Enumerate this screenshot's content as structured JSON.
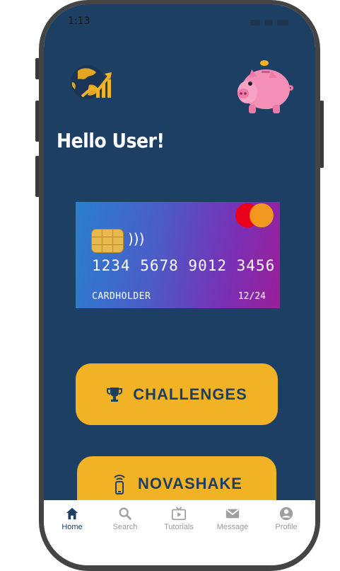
{
  "status_bar": {
    "time": "1:13"
  },
  "header": {
    "greeting": "Hello User!",
    "globe_icon": "globe-growth-chart-icon",
    "piggy_icon": "piggy-bank-icon"
  },
  "card": {
    "number": "1234 5678 9012 3456",
    "holder": "CARDHOLDER",
    "expiry": "12/24",
    "brand": "mastercard",
    "gradient": [
      "#2a7fd0",
      "#7a2fb4",
      "#9b1f99"
    ]
  },
  "buttons": {
    "challenges": {
      "label": "CHALLENGES",
      "icon": "trophy-icon"
    },
    "novashake": {
      "label": "NOVASHAKE",
      "icon": "phone-vibrate-icon"
    }
  },
  "tabbar": {
    "items": [
      {
        "label": "Home",
        "icon": "home-icon",
        "active": true
      },
      {
        "label": "Search",
        "icon": "search-icon",
        "active": false
      },
      {
        "label": "Tutorials",
        "icon": "video-icon",
        "active": false
      },
      {
        "label": "Message",
        "icon": "mail-icon",
        "active": false
      },
      {
        "label": "Profile",
        "icon": "user-icon",
        "active": false
      }
    ]
  },
  "colors": {
    "background": "#1d3f64",
    "accent": "#f2b225",
    "text_light": "#ffffff",
    "tab_inactive": "#9a9a9a"
  }
}
